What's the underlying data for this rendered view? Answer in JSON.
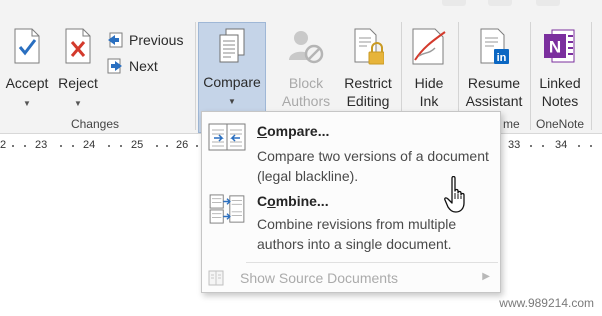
{
  "ribbon": {
    "accept": {
      "label": "Accept"
    },
    "reject": {
      "label": "Reject"
    },
    "previous": {
      "label": "Previous"
    },
    "next": {
      "label": "Next"
    },
    "changes_group": "Changes",
    "compare": {
      "label": "Compare"
    },
    "block_authors": {
      "line1": "Block",
      "line2": "Authors"
    },
    "restrict_editing": {
      "line1": "Restrict",
      "line2": "Editing"
    },
    "hide_ink": {
      "line1": "Hide",
      "line2": "Ink"
    },
    "resume_assistant": {
      "line1": "Resume",
      "line2": "Assistant"
    },
    "resume_group_partial": "me",
    "linked_notes": {
      "line1": "Linked",
      "line2": "Notes"
    },
    "onenote_group": "OneNote"
  },
  "ruler": {
    "left_labels": [
      "2",
      "23",
      "24",
      "25",
      "26"
    ],
    "right_labels": [
      "33",
      "34"
    ]
  },
  "menu": {
    "compare": {
      "title_accel": "C",
      "title_rest": "ompare...",
      "desc": "Compare two versions of a document (legal blackline)."
    },
    "combine": {
      "title_accel": "C",
      "title_mid": "o",
      "title_rest": "mbine...",
      "desc": "Combine revisions from multiple authors into a single document."
    },
    "show_source": {
      "label": "Show Source Documents"
    }
  },
  "watermark": "www.989214.com",
  "colors": {
    "ribbon_bg": "#f3f3f3",
    "compare_active_bg": "#c5d4e8",
    "onenote_purple": "#7b2f9e",
    "linkedin_blue": "#0a66c2",
    "accept_blue": "#2a6fc0",
    "reject_red": "#d33a2c"
  }
}
